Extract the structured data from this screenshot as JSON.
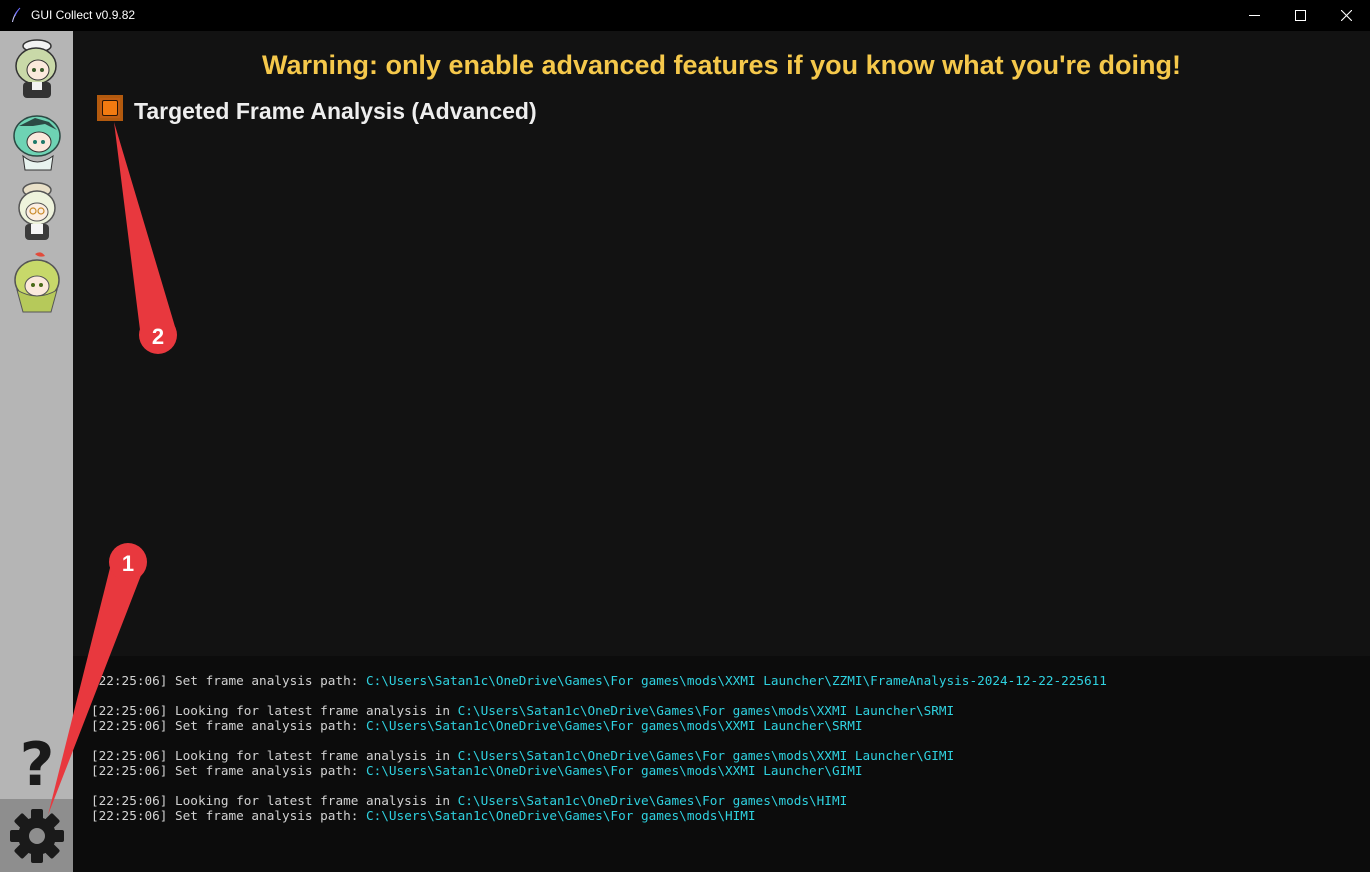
{
  "window": {
    "title": "GUI Collect v0.9.82",
    "controls": [
      "minimize-icon",
      "maximize-icon",
      "close-icon"
    ]
  },
  "sidebar": {
    "avatars": [
      {
        "name": "avatar-1"
      },
      {
        "name": "avatar-2"
      },
      {
        "name": "avatar-3"
      },
      {
        "name": "avatar-4"
      }
    ],
    "help_label": "?",
    "settings_icon": "gear-icon"
  },
  "main": {
    "warning": "Warning: only enable advanced features if you know what you're doing!",
    "option_label": "Targeted Frame Analysis (Advanced)",
    "option_checked": false
  },
  "console": {
    "lines": [
      {
        "time": "[22:25:06]",
        "text": " Set frame analysis path: ",
        "path": "C:\\Users\\Satan1c\\OneDrive\\Games\\For games\\mods\\XXMI Launcher\\ZZMI\\FrameAnalysis-2024-12-22-225611"
      },
      {
        "time": "[22:25:06]",
        "text": " Looking for latest frame analysis in ",
        "path": "C:\\Users\\Satan1c\\OneDrive\\Games\\For games\\mods\\XXMI Launcher\\SRMI"
      },
      {
        "time": "[22:25:06]",
        "text": " Set frame analysis path: ",
        "path": "C:\\Users\\Satan1c\\OneDrive\\Games\\For games\\mods\\XXMI Launcher\\SRMI"
      },
      {
        "time": "[22:25:06]",
        "text": " Looking for latest frame analysis in ",
        "path": "C:\\Users\\Satan1c\\OneDrive\\Games\\For games\\mods\\XXMI Launcher\\GIMI"
      },
      {
        "time": "[22:25:06]",
        "text": " Set frame analysis path: ",
        "path": "C:\\Users\\Satan1c\\OneDrive\\Games\\For games\\mods\\XXMI Launcher\\GIMI"
      },
      {
        "time": "[22:25:06]",
        "text": " Looking for latest frame analysis in ",
        "path": "C:\\Users\\Satan1c\\OneDrive\\Games\\For games\\mods\\HIMI"
      },
      {
        "time": "[22:25:06]",
        "text": " Set frame analysis path: ",
        "path": "C:\\Users\\Satan1c\\OneDrive\\Games\\For games\\mods\\HIMI"
      }
    ]
  },
  "annotations": {
    "marker_1": "1",
    "marker_2": "2"
  },
  "colors": {
    "warning": "#f5c84b",
    "checkbox": "#f27a11",
    "path": "#2fd2e0",
    "marker": "#e8383e"
  }
}
